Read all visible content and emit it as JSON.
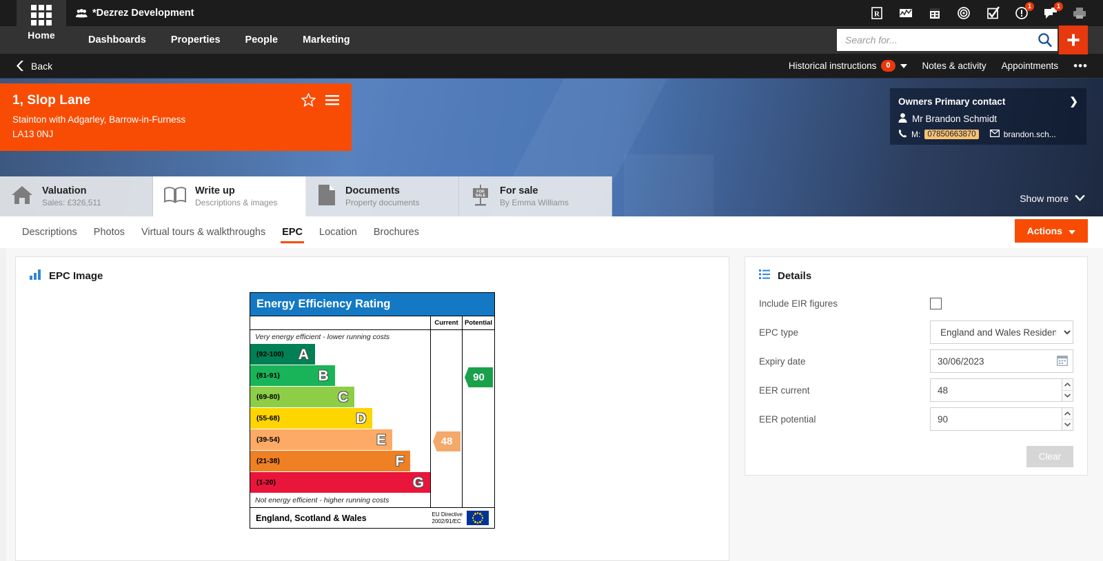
{
  "topbar": {
    "app_label": "Home",
    "brand": "*Dezrez Development",
    "icons": [
      {
        "name": "reports-icon",
        "glyph": "R",
        "badge": null
      },
      {
        "name": "analytics-icon",
        "glyph": "chart",
        "badge": null
      },
      {
        "name": "calendar-icon",
        "glyph": "calendar",
        "badge": null
      },
      {
        "name": "target-icon",
        "glyph": "target",
        "badge": null
      },
      {
        "name": "tasks-icon",
        "glyph": "checkbox",
        "badge": null
      },
      {
        "name": "alerts-icon",
        "glyph": "exclamation",
        "badge": "1"
      },
      {
        "name": "messages-icon",
        "glyph": "speech",
        "badge": "1"
      },
      {
        "name": "print-icon",
        "glyph": "printer",
        "badge": null
      }
    ]
  },
  "nav": {
    "links": [
      "Dashboards",
      "Properties",
      "People",
      "Marketing"
    ]
  },
  "search": {
    "placeholder": "Search for...",
    "value": ""
  },
  "subbar": {
    "back": "Back",
    "historical_instructions": "Historical instructions",
    "historical_count": "0",
    "notes": "Notes & activity",
    "appointments": "Appointments",
    "more": "•••"
  },
  "property": {
    "title": "1, Slop Lane",
    "address": "Stainton with Adgarley, Barrow-in-Furness",
    "postcode": "LA13 0NJ"
  },
  "owner": {
    "heading": "Owners Primary contact",
    "name": "Mr Brandon Schmidt",
    "mobile_label": "M:",
    "mobile": "07850663870",
    "email": "brandon.sch..."
  },
  "bigtabs": [
    {
      "title": "Valuation",
      "sub": "Sales: £326,511",
      "icon": "house-icon",
      "active": false
    },
    {
      "title": "Write up",
      "sub": "Descriptions & images",
      "icon": "book-icon",
      "active": true
    },
    {
      "title": "Documents",
      "sub": "Property documents",
      "icon": "document-icon",
      "active": false
    },
    {
      "title": "For sale",
      "sub": "By Emma Williams",
      "icon": "for-sale-sign-icon",
      "active": false
    }
  ],
  "show_more": "Show more",
  "subtabs": [
    {
      "label": "Descriptions",
      "active": false
    },
    {
      "label": "Photos",
      "active": false
    },
    {
      "label": "Virtual tours & walkthroughs",
      "active": false
    },
    {
      "label": "EPC",
      "active": true
    },
    {
      "label": "Location",
      "active": false
    },
    {
      "label": "Brochures",
      "active": false
    }
  ],
  "actions_button": "Actions",
  "epc_panel_title": "EPC Image",
  "details_panel_title": "Details",
  "details": {
    "include_eir_label": "Include EIR figures",
    "include_eir_checked": false,
    "epc_type_label": "EPC type",
    "epc_type_value": "England and Wales Residential",
    "expiry_label": "Expiry date",
    "expiry_value": "30/06/2023",
    "eer_current_label": "EER current",
    "eer_current_value": "48",
    "eer_potential_label": "EER potential",
    "eer_potential_value": "90",
    "clear_button": "Clear"
  },
  "chart_data": {
    "type": "bar",
    "title": "Energy Efficiency Rating",
    "subtitle_top": "Very energy efficient - lower running costs",
    "subtitle_bottom": "Not energy efficient - higher running costs",
    "columns": [
      "Current",
      "Potential"
    ],
    "footer_region": "England, Scotland & Wales",
    "footer_directive_line1": "EU Directive",
    "footer_directive_line2": "2002/91/EC",
    "header_color": "#1479c4",
    "current_value": 48,
    "current_band": "E",
    "current_color": "#f3a96a",
    "potential_value": 90,
    "potential_band": "B",
    "potential_color": "#19a04b",
    "categories": [
      "A",
      "B",
      "C",
      "D",
      "E",
      "F",
      "G"
    ],
    "bands": [
      {
        "letter": "A",
        "range": "(92-100)",
        "width_pct": 36,
        "color": "#008054"
      },
      {
        "letter": "B",
        "range": "(81-91)",
        "width_pct": 47,
        "color": "#19b459"
      },
      {
        "letter": "C",
        "range": "(69-80)",
        "width_pct": 58,
        "color": "#8dce46"
      },
      {
        "letter": "D",
        "range": "(55-68)",
        "width_pct": 68,
        "color": "#ffd500"
      },
      {
        "letter": "E",
        "range": "(39-54)",
        "width_pct": 79,
        "color": "#fcaa65"
      },
      {
        "letter": "F",
        "range": "(21-38)",
        "width_pct": 89,
        "color": "#ef8023"
      },
      {
        "letter": "G",
        "range": "(1-20)",
        "width_pct": 100,
        "color": "#e9153b"
      }
    ],
    "xlabel": "",
    "ylabel": "",
    "grid": false,
    "legend": "none"
  }
}
